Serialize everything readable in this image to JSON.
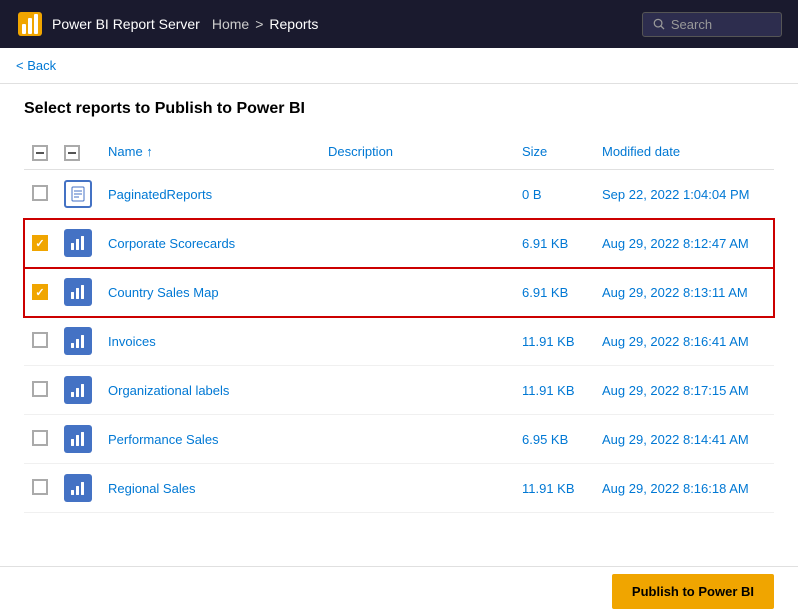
{
  "header": {
    "logo_alt": "Power BI logo",
    "app_name": "Power BI Report Server",
    "breadcrumb": {
      "home": "Home",
      "separator": ">",
      "current": "Reports"
    },
    "search": {
      "placeholder": "Search",
      "icon": "search"
    }
  },
  "back_button": "< Back",
  "page_title": "Select reports to Publish to Power BI",
  "table": {
    "columns": {
      "name": "Name ↑",
      "description": "Description",
      "size": "Size",
      "modified_date": "Modified date"
    },
    "rows": [
      {
        "id": "paginated-reports",
        "name": "PaginatedReports",
        "description": "",
        "size": "0 B",
        "modified": "Sep 22, 2022 1:04:04 PM",
        "checked": false,
        "icon_type": "paginated",
        "selected": false
      },
      {
        "id": "corporate-scorecards",
        "name": "Corporate Scorecards",
        "description": "",
        "size": "6.91 KB",
        "modified": "Aug 29, 2022 8:12:47 AM",
        "checked": true,
        "icon_type": "powerbi",
        "selected": true
      },
      {
        "id": "country-sales-map",
        "name": "Country Sales Map",
        "description": "",
        "size": "6.91 KB",
        "modified": "Aug 29, 2022 8:13:11 AM",
        "checked": true,
        "icon_type": "powerbi",
        "selected": true
      },
      {
        "id": "invoices",
        "name": "Invoices",
        "description": "",
        "size": "11.91 KB",
        "modified": "Aug 29, 2022 8:16:41 AM",
        "checked": false,
        "icon_type": "small-bar",
        "selected": false
      },
      {
        "id": "organizational-labels",
        "name": "Organizational labels",
        "description": "",
        "size": "11.91 KB",
        "modified": "Aug 29, 2022 8:17:15 AM",
        "checked": false,
        "icon_type": "small-bar",
        "selected": false
      },
      {
        "id": "performance-sales",
        "name": "Performance Sales",
        "description": "",
        "size": "6.95 KB",
        "modified": "Aug 29, 2022 8:14:41 AM",
        "checked": false,
        "icon_type": "powerbi",
        "selected": false
      },
      {
        "id": "regional-sales",
        "name": "Regional Sales",
        "description": "",
        "size": "11.91 KB",
        "modified": "Aug 29, 2022 8:16:18 AM",
        "checked": false,
        "icon_type": "small-bar",
        "selected": false
      }
    ]
  },
  "publish_button": "Publish to Power BI"
}
